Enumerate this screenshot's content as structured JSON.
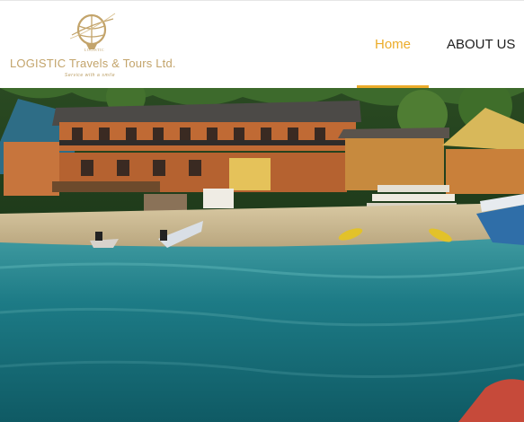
{
  "header": {
    "logo": {
      "small_text": "LOGISTIC",
      "name": "LOGISTIC Travels & Tours Ltd.",
      "tagline": "Service with a smile"
    },
    "nav": [
      {
        "label": "Home",
        "active": true
      },
      {
        "label": "ABOUT US",
        "active": false
      }
    ],
    "accent_color": "#ecac2a",
    "logo_color": "#c3a46b"
  },
  "hero": {
    "scene": "beach-resort-photo"
  }
}
